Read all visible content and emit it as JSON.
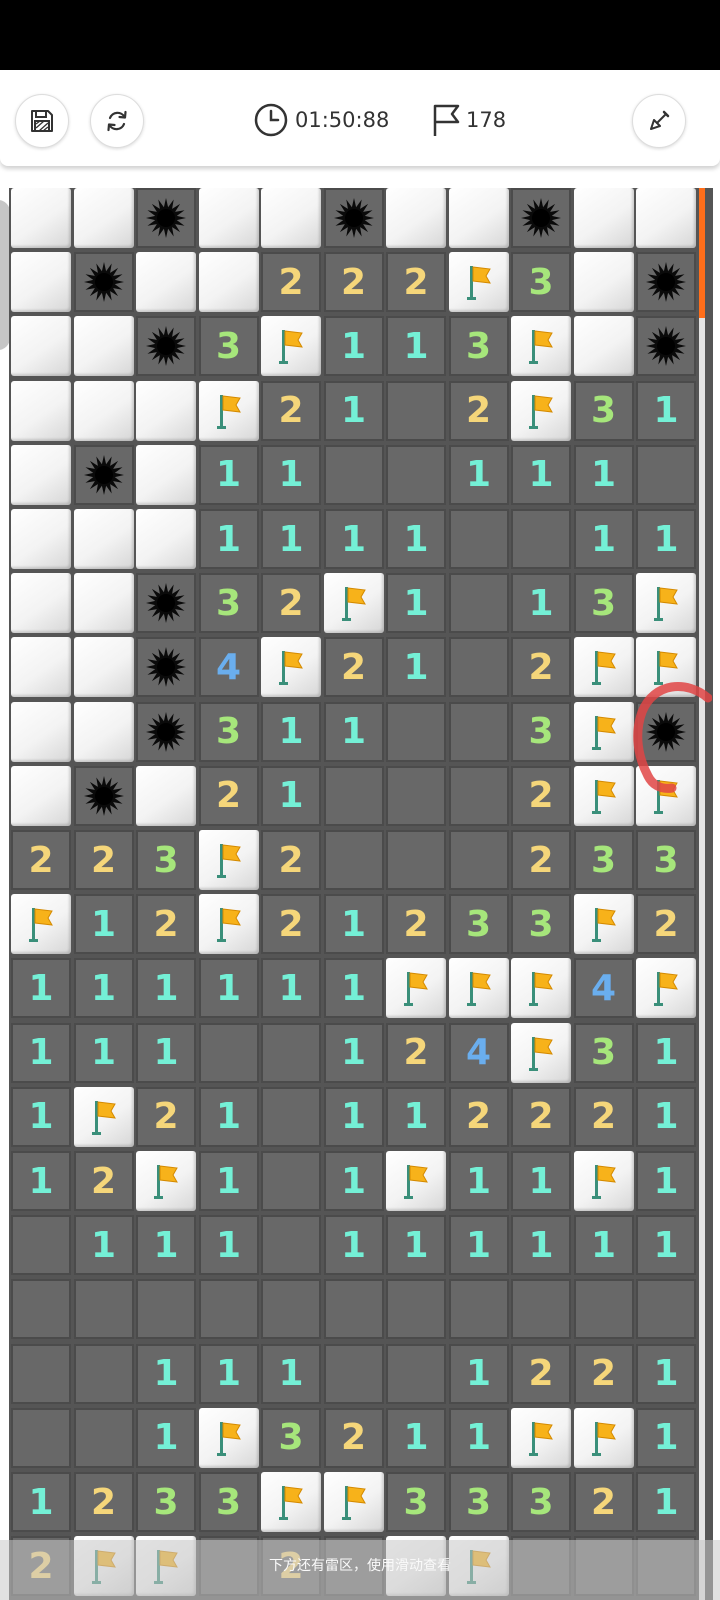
{
  "toolbar": {
    "timer": "01:50:88",
    "flag_count": "178",
    "save_icon": "save-icon",
    "restart_icon": "refresh-icon",
    "hint_icon": "shovel-icon"
  },
  "colors": {
    "accent": "#ff6e1a",
    "number_1": "#74f0d6",
    "number_2": "#f5d67a",
    "number_3": "#a6e67b",
    "number_4": "#6aaeee",
    "flag": "#f7b21a",
    "red_annotation": "#e04545"
  },
  "legend": {
    "H": "hidden",
    "M": "mine",
    "F": "flag",
    "0": "open-empty",
    "1-8": "open-number"
  },
  "board": {
    "columns": 11,
    "rows": [
      [
        "H",
        "H",
        "M",
        "H",
        "H",
        "M",
        "H",
        "H",
        "M",
        "H",
        "H"
      ],
      [
        "H",
        "M",
        "H",
        "H",
        "2",
        "2",
        "2",
        "F",
        "3",
        "H",
        "M"
      ],
      [
        "H",
        "H",
        "M",
        "3",
        "F",
        "1",
        "1",
        "3",
        "F",
        "H",
        "M"
      ],
      [
        "H",
        "H",
        "H",
        "F",
        "2",
        "1",
        "0",
        "2",
        "F",
        "3",
        "1"
      ],
      [
        "H",
        "M",
        "H",
        "1",
        "1",
        "0",
        "0",
        "1",
        "1",
        "1",
        "0"
      ],
      [
        "H",
        "H",
        "H",
        "1",
        "1",
        "1",
        "1",
        "0",
        "0",
        "1",
        "1"
      ],
      [
        "H",
        "H",
        "M",
        "3",
        "2",
        "F",
        "1",
        "0",
        "1",
        "3",
        "F"
      ],
      [
        "H",
        "H",
        "M",
        "4",
        "F",
        "2",
        "1",
        "0",
        "2",
        "F",
        "F"
      ],
      [
        "H",
        "H",
        "M",
        "3",
        "1",
        "1",
        "0",
        "0",
        "3",
        "F",
        "M"
      ],
      [
        "H",
        "M",
        "H",
        "2",
        "1",
        "0",
        "0",
        "0",
        "2",
        "F",
        "F"
      ],
      [
        "2",
        "2",
        "3",
        "F",
        "2",
        "0",
        "0",
        "0",
        "2",
        "3",
        "3"
      ],
      [
        "F",
        "1",
        "2",
        "F",
        "2",
        "1",
        "2",
        "3",
        "3",
        "F",
        "2"
      ],
      [
        "1",
        "1",
        "1",
        "1",
        "1",
        "1",
        "F",
        "F",
        "F",
        "4",
        "F"
      ],
      [
        "1",
        "1",
        "1",
        "0",
        "0",
        "1",
        "2",
        "4",
        "F",
        "3",
        "1"
      ],
      [
        "1",
        "F",
        "2",
        "1",
        "0",
        "1",
        "1",
        "2",
        "2",
        "2",
        "1"
      ],
      [
        "1",
        "2",
        "F",
        "1",
        "0",
        "1",
        "F",
        "1",
        "1",
        "F",
        "1"
      ],
      [
        "0",
        "1",
        "1",
        "1",
        "0",
        "1",
        "1",
        "1",
        "1",
        "1",
        "1"
      ],
      [
        "0",
        "0",
        "0",
        "0",
        "0",
        "0",
        "0",
        "0",
        "0",
        "0",
        "0"
      ],
      [
        "0",
        "0",
        "1",
        "1",
        "1",
        "0",
        "0",
        "1",
        "2",
        "2",
        "1"
      ],
      [
        "0",
        "0",
        "1",
        "F",
        "3",
        "2",
        "1",
        "1",
        "F",
        "F",
        "1"
      ],
      [
        "1",
        "2",
        "3",
        "3",
        "F",
        "F",
        "3",
        "3",
        "3",
        "2",
        "1"
      ],
      [
        "2",
        "F",
        "F",
        "0",
        "2",
        "0",
        "H",
        "F",
        "0",
        "0",
        "0"
      ]
    ]
  },
  "bottom_hint": "下方还有雷区，使用滑动查看"
}
